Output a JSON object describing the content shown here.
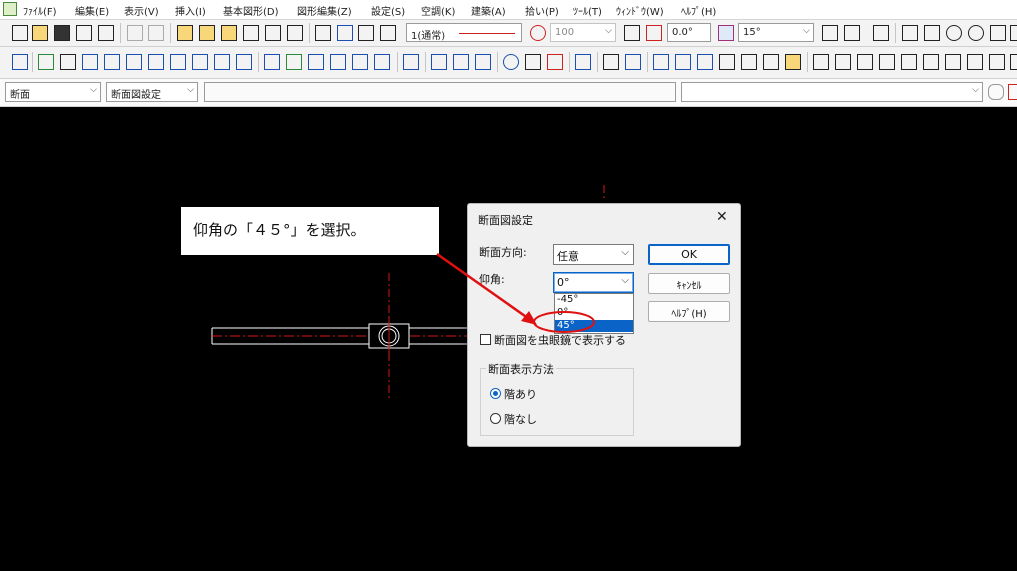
{
  "menu": {
    "items": [
      "ﾌｧｲﾙ(F)",
      "編集(E)",
      "表示(V)",
      "挿入(I)",
      "基本図形(D)",
      "図形編集(Z)",
      "設定(S)",
      "空調(K)",
      "建築(A)",
      "拾い(P)",
      "ﾂｰﾙ(T)",
      "ｳｨﾝﾄﾞｳ(W)",
      "ﾍﾙﾌﾟ(H)"
    ]
  },
  "toolbar1": {
    "layer_value": "1(通常)",
    "line_weight_value": "100",
    "angle_value": "0.0°",
    "snap_angle_value": "15°"
  },
  "toolbar3": {
    "mode_value": "断面",
    "command_value": "断面図設定",
    "command_input_value": "",
    "right_input_value": ""
  },
  "callout": {
    "text": "仰角の「４５°」を選択。"
  },
  "dialog": {
    "title": "断面図設定",
    "close_glyph": "✕",
    "direction_label": "断面方向:",
    "direction_value": "任意",
    "elevation_label": "仰角:",
    "elevation_value": "0°",
    "elevation_options": [
      "-45°",
      "0°",
      "45°"
    ],
    "elevation_highlighted": "45°",
    "ok_label": "OK",
    "cancel_label": "ｷｬﾝｾﾙ",
    "help_label": "ﾍﾙﾌﾟ(H)",
    "magnifier_checkbox_label": "断面図を虫眼鏡で表示する",
    "magnifier_checked": false,
    "display_group_title": "断面表示方法",
    "radio_with_floor": "階あり",
    "radio_without_floor": "階なし",
    "selected_display": "階あり"
  },
  "colors": {
    "accent": "#0a64c8",
    "annotation_red": "#e01010",
    "drawing_white": "#ffffff",
    "centerline_red": "#d01818",
    "canvas_bg": "#000000"
  }
}
